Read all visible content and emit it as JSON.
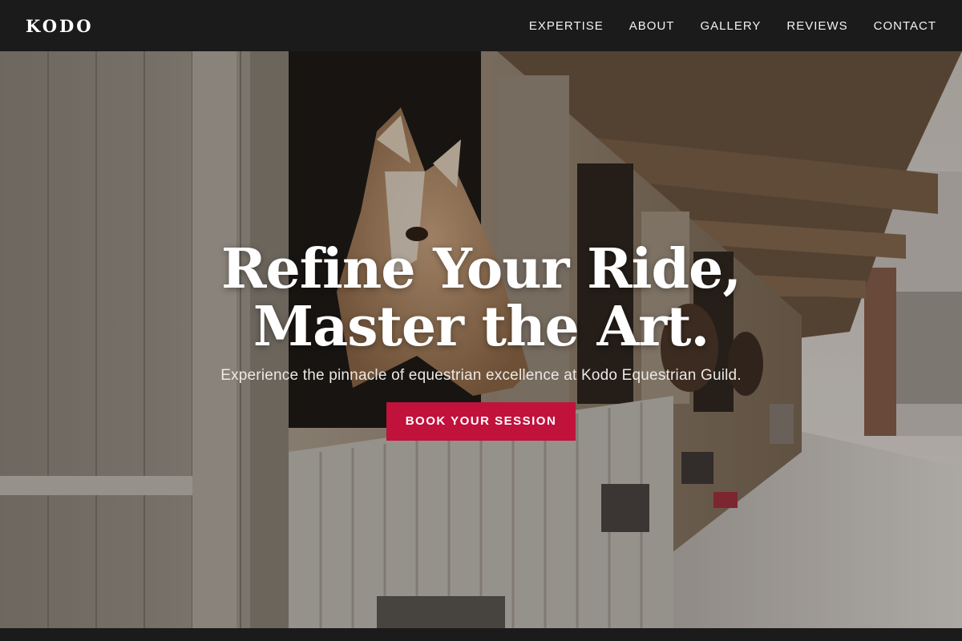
{
  "brand": {
    "logo": "KODO"
  },
  "nav": {
    "items": [
      {
        "label": "EXPERTISE"
      },
      {
        "label": "ABOUT"
      },
      {
        "label": "GALLERY"
      },
      {
        "label": "REVIEWS"
      },
      {
        "label": "CONTACT"
      }
    ]
  },
  "hero": {
    "title_line1": "Refine Your Ride,",
    "title_line2": "Master the Art.",
    "subtitle": "Experience the pinnacle of equestrian excellence at Kodo Equestrian Guild.",
    "cta_label": "BOOK YOUR SESSION",
    "image_subject": "horse-in-stable-photo"
  },
  "colors": {
    "navbar_bg": "#1b1b1b",
    "accent": "#c1123c",
    "text_light": "#ffffff"
  }
}
